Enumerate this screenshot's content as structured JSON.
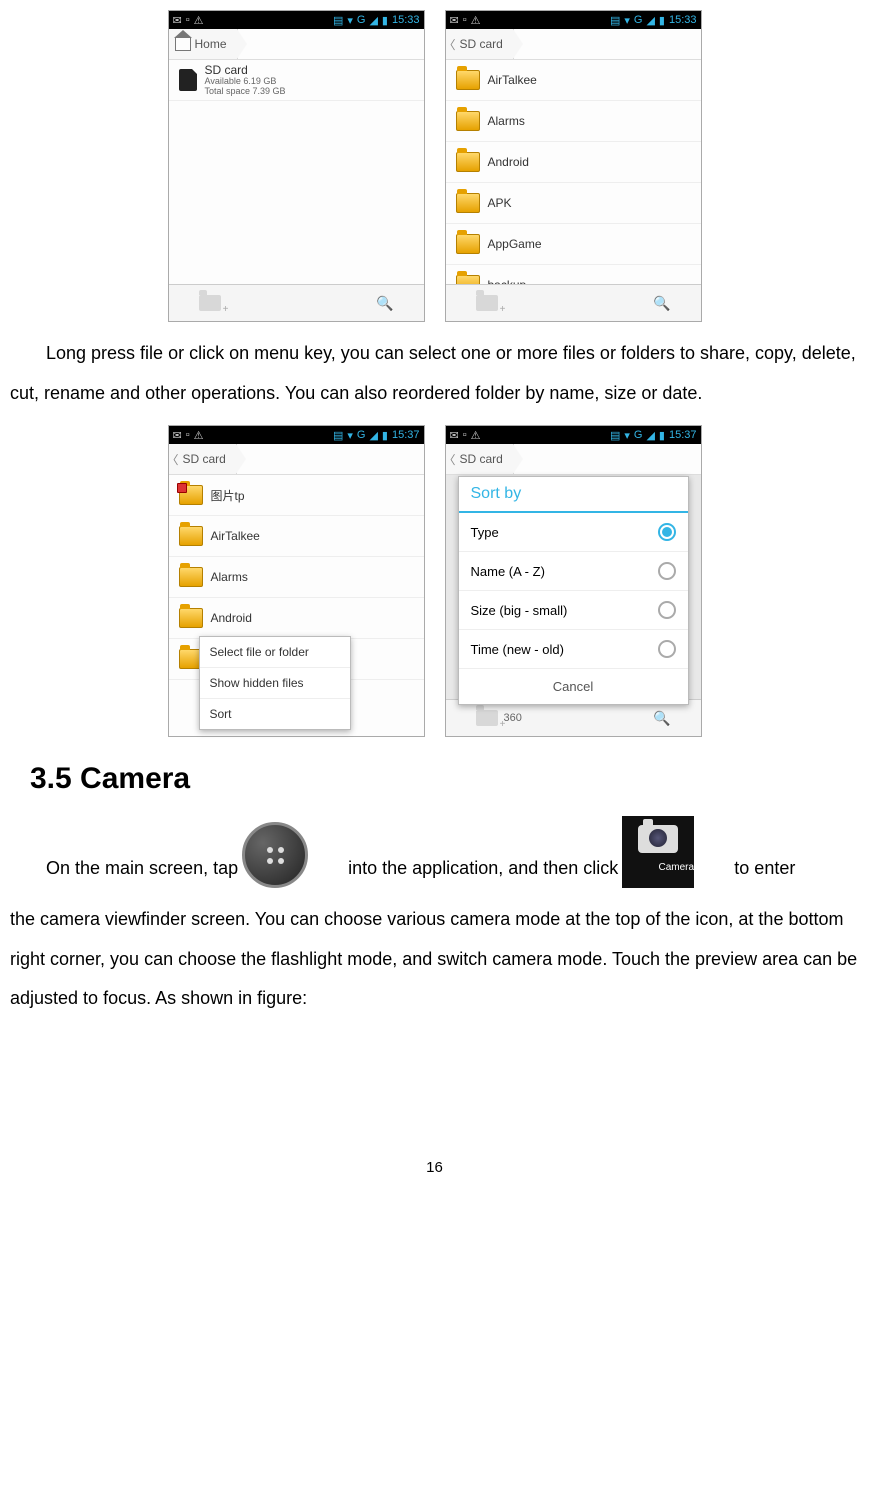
{
  "screens": {
    "home": {
      "statusbar_time": "15:33",
      "statusbar_net": "G",
      "breadcrumb": "Home",
      "breadcrumb_icon": "home-icon",
      "list": [
        {
          "name": "SD card",
          "sub1": "Available 6.19 GB",
          "sub2": "Total space 7.39 GB",
          "icon": "sd-icon"
        }
      ]
    },
    "sdcard": {
      "statusbar_time": "15:33",
      "statusbar_net": "G",
      "breadcrumb": "SD card",
      "list": [
        {
          "name": "AirTalkee",
          "icon": "folder"
        },
        {
          "name": "Alarms",
          "icon": "folder"
        },
        {
          "name": "Android",
          "icon": "folder"
        },
        {
          "name": "APK",
          "icon": "folder"
        },
        {
          "name": "AppGame",
          "icon": "folder"
        },
        {
          "name": "backup",
          "icon": "folder"
        }
      ]
    },
    "sdcard_menu": {
      "statusbar_time": "15:37",
      "statusbar_net": "G",
      "breadcrumb": "SD card",
      "list": [
        {
          "name": "图片tp",
          "icon": "folder-marked"
        },
        {
          "name": "AirTalkee",
          "icon": "folder"
        },
        {
          "name": "Alarms",
          "icon": "folder"
        },
        {
          "name": "Android",
          "icon": "folder"
        }
      ],
      "menu": [
        "Select file or folder",
        "Show hidden files",
        "Sort"
      ]
    },
    "sort_dialog": {
      "statusbar_time": "15:37",
      "statusbar_net": "G",
      "breadcrumb": "SD card",
      "title": "Sort by",
      "options": [
        {
          "label": "Type",
          "selected": true
        },
        {
          "label": "Name (A - Z)",
          "selected": false
        },
        {
          "label": "Size (big - small)",
          "selected": false
        },
        {
          "label": "Time (new - old)",
          "selected": false
        }
      ],
      "cancel": "Cancel",
      "bg_item": "360"
    }
  },
  "text": {
    "para1": "Long press file or click on menu key, you can select one or more files or folders to share, copy, delete, cut, rename and other operations. You can also reordered folder by name, size or date.",
    "heading": "3.5 Camera",
    "para2a": "On the main screen, tap ",
    "para2b": " into the application, and then click ",
    "para2c": " to enter",
    "para2d": "the camera viewfinder screen. You can choose various camera mode at the top of the icon, at the bottom right corner, you can choose the flashlight mode, and switch camera mode. Touch the preview area can be adjusted to focus. As shown in figure:",
    "camera_label": "Camera",
    "page_number": "16"
  }
}
